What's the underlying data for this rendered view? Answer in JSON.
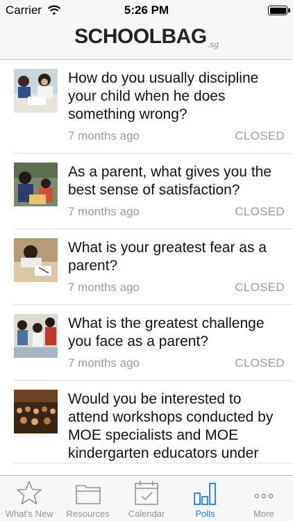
{
  "status_bar": {
    "carrier": "Carrier",
    "time": "5:26 PM",
    "battery_level": 1.0
  },
  "header": {
    "logo_part1": "SCHOOL",
    "logo_part2": "BAG",
    "logo_suffix": ".sg"
  },
  "polls": [
    {
      "question": "How do you usually discipline your child when he does something wrong?",
      "time": "7 months ago",
      "status": "CLOSED",
      "thumbnail": "children-in-classroom-photo"
    },
    {
      "question": "As a parent, what gives you the best sense of satisfaction?",
      "time": "7 months ago",
      "status": "CLOSED",
      "thumbnail": "teacher-with-students-photo"
    },
    {
      "question": "What is your greatest fear as a parent?",
      "time": "7 months ago",
      "status": "CLOSED",
      "thumbnail": "child-writing-photo"
    },
    {
      "question": "What is the greatest challenge you face as a parent?",
      "time": "7 months ago",
      "status": "CLOSED",
      "thumbnail": "children-activity-photo"
    },
    {
      "question": "Would you be interested to attend workshops conducted by MOE specialists and MOE kindergarten educators under",
      "time": "",
      "status": "",
      "thumbnail": "workshop-audience-photo"
    }
  ],
  "tabs": [
    {
      "label": "What's New",
      "icon": "star-icon",
      "active": false
    },
    {
      "label": "Resources",
      "icon": "folder-icon",
      "active": false
    },
    {
      "label": "Calendar",
      "icon": "calendar-icon",
      "active": false
    },
    {
      "label": "Polls",
      "icon": "bar-chart-icon",
      "active": true
    },
    {
      "label": "More",
      "icon": "more-icon",
      "active": false
    }
  ],
  "colors": {
    "active_tab": "#1a7fe6",
    "inactive_tab": "#929292",
    "meta_text": "#9b9b9b"
  }
}
